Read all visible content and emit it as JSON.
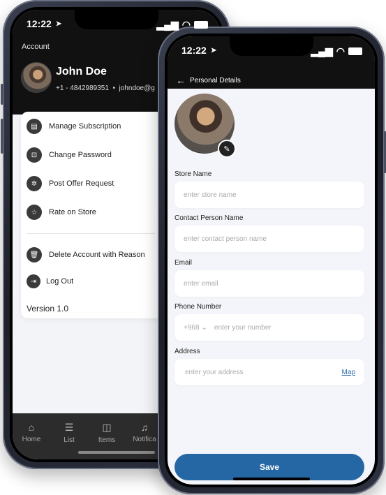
{
  "back_phone": {
    "status": {
      "time": "12:22"
    },
    "header": {
      "title": "Account",
      "name": "John Doe",
      "phone": "+1 - 4842989351",
      "email": "johndoe@g"
    },
    "menu": [
      {
        "label": "Manage Subscription",
        "icon": "subscription-icon"
      },
      {
        "label": "Change Password",
        "icon": "lock-icon"
      },
      {
        "label": "Post Offer Request",
        "icon": "offer-icon"
      },
      {
        "label": "Rate on Store",
        "icon": "star-icon"
      },
      {
        "label": "Delete Account with Reason",
        "icon": "trash-icon"
      },
      {
        "label": "Log Out",
        "icon": "logout-icon"
      }
    ],
    "version": "Version 1.0",
    "tabs": [
      {
        "label": "Home",
        "icon": "home-icon"
      },
      {
        "label": "List",
        "icon": "list-icon"
      },
      {
        "label": "Items",
        "icon": "items-icon"
      },
      {
        "label": "Notifica",
        "icon": "bell-icon"
      }
    ]
  },
  "front_phone": {
    "status": {
      "time": "12:22"
    },
    "header": {
      "title": "Personal Details"
    },
    "form": {
      "store_name": {
        "label": "Store Name",
        "placeholder": "enter store name"
      },
      "contact_person": {
        "label": "Contact Person Name",
        "placeholder": "enter contact person name"
      },
      "email": {
        "label": "Email",
        "placeholder": "enter email"
      },
      "phone": {
        "label": "Phone Number",
        "country_code": "+968",
        "placeholder": "enter your number"
      },
      "address": {
        "label": "Address",
        "placeholder": "enter your address",
        "map_link": "Map"
      }
    },
    "save_label": "Save"
  },
  "colors": {
    "accent": "#2467a4",
    "header_bg": "#111111"
  }
}
